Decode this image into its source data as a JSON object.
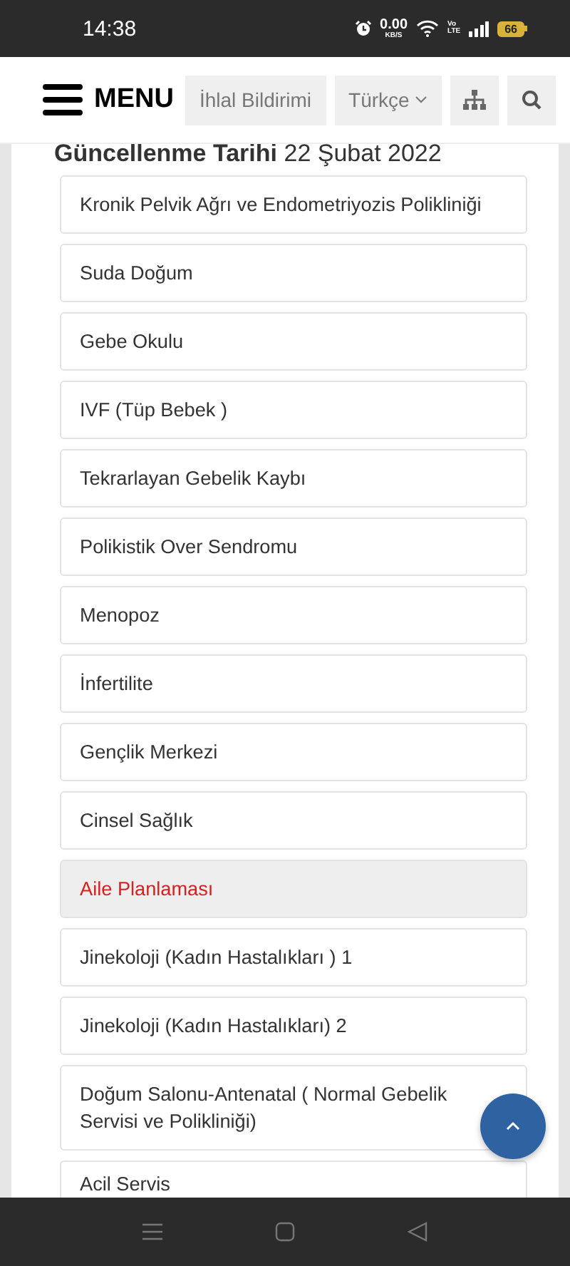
{
  "status_bar": {
    "time": "14:38",
    "data_speed": "0.00",
    "data_unit": "KB/S",
    "network": "Vo\nLTE",
    "battery": "66"
  },
  "header": {
    "menu_label": "MENU",
    "report_button": "İhlal Bildirimi",
    "language": "Türkçe"
  },
  "updated": {
    "label": "Güncellenme Tarihi",
    "date": "22 Şubat 2022"
  },
  "items": [
    {
      "label": "Kronik Pelvik Ağrı ve Endometriyozis Polikliniği",
      "selected": false
    },
    {
      "label": "Suda Doğum",
      "selected": false
    },
    {
      "label": "Gebe Okulu",
      "selected": false
    },
    {
      "label": "IVF (Tüp Bebek )",
      "selected": false
    },
    {
      "label": "Tekrarlayan Gebelik Kaybı",
      "selected": false
    },
    {
      "label": "Polikistik Over Sendromu",
      "selected": false
    },
    {
      "label": "Menopoz",
      "selected": false
    },
    {
      "label": "İnfertilite",
      "selected": false
    },
    {
      "label": "Gençlik Merkezi",
      "selected": false
    },
    {
      "label": "Cinsel Sağlık",
      "selected": false
    },
    {
      "label": "Aile Planlaması",
      "selected": true
    },
    {
      "label": "Jinekoloji (Kadın Hastalıkları ) 1",
      "selected": false
    },
    {
      "label": "Jinekoloji (Kadın Hastalıkları) 2",
      "selected": false
    },
    {
      "label": "Doğum Salonu-Antenatal ( Normal Gebelik Servisi ve Polikliniği)",
      "selected": false
    },
    {
      "label": "Acil Servis",
      "selected": false
    }
  ]
}
